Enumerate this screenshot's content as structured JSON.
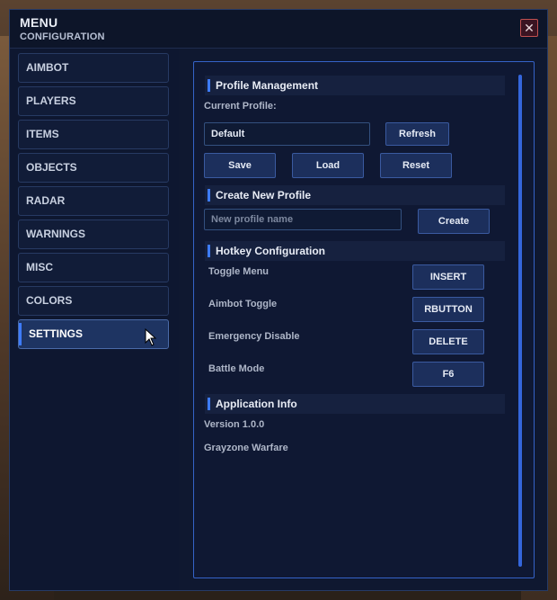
{
  "window": {
    "title": "MENU",
    "subtitle": "CONFIGURATION",
    "close_label": "✕"
  },
  "sidebar": {
    "items": [
      {
        "label": "AIMBOT"
      },
      {
        "label": "PLAYERS"
      },
      {
        "label": "ITEMS"
      },
      {
        "label": "OBJECTS"
      },
      {
        "label": "RADAR"
      },
      {
        "label": "WARNINGS"
      },
      {
        "label": "MISC"
      },
      {
        "label": "COLORS"
      },
      {
        "label": "SETTINGS",
        "active": true
      }
    ]
  },
  "profile": {
    "header": "Profile Management",
    "current_label": "Current Profile:",
    "current_value": "Default",
    "refresh_label": "Refresh",
    "save_label": "Save",
    "load_label": "Load",
    "reset_label": "Reset"
  },
  "create": {
    "header": "Create New Profile",
    "placeholder": "New profile name",
    "create_label": "Create"
  },
  "hotkeys": {
    "header": "Hotkey Configuration",
    "rows": [
      {
        "label": "Toggle Menu",
        "key": "INSERT"
      },
      {
        "label": "Aimbot Toggle",
        "key": "RBUTTON"
      },
      {
        "label": "Emergency Disable",
        "key": "DELETE"
      },
      {
        "label": "Battle Mode",
        "key": "F6"
      }
    ]
  },
  "app_info": {
    "header": "Application Info",
    "version": "Version 1.0.0",
    "game": "Grayzone Warfare"
  },
  "colors": {
    "accent": "#3d7bff",
    "panel": "#0f1833",
    "border": "#3563c8"
  }
}
